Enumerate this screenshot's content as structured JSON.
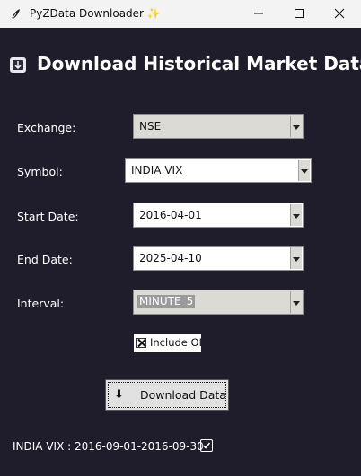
{
  "window": {
    "title": "PyZData Downloader ✨",
    "controls": {
      "minimize": "minimize-icon",
      "maximize": "maximize-icon",
      "close": "close-icon"
    }
  },
  "heading": {
    "icon": "book-icon",
    "text": "Download Historical Market Data"
  },
  "form": {
    "exchange": {
      "label": "Exchange:",
      "value": "NSE"
    },
    "symbol": {
      "label": "Symbol:",
      "value": "INDIA VIX"
    },
    "start_date": {
      "label": "Start Date:",
      "value": "2016-04-01"
    },
    "end_date": {
      "label": "End Date:",
      "value": "2025-04-10"
    },
    "interval": {
      "label": "Interval:",
      "value": "MINUTE_5"
    },
    "include_oi": {
      "label": "Include OI",
      "checked": true
    }
  },
  "download_button": {
    "icon": "download-arrow-icon",
    "label": "Download Data",
    "glyph": "⬇"
  },
  "status": {
    "text": "INDIA VIX : 2016-09-01-2016-09-30",
    "icon": "check-box-icon"
  },
  "colors": {
    "background": "#1f1d2c",
    "titlebar": "#f3f3f3",
    "text": "#ffffff"
  }
}
